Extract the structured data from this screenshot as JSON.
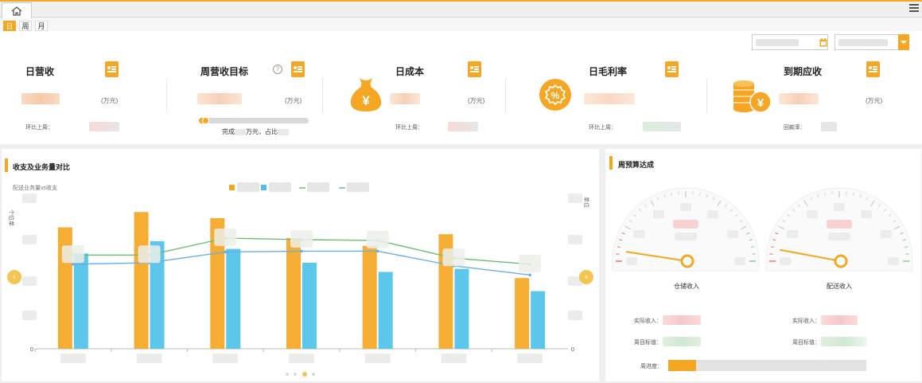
{
  "tabs": {
    "period": [
      "日",
      "周",
      "月"
    ],
    "active_index": 0
  },
  "icons": {
    "home": "home-icon",
    "menu": "hamburger-menu-icon",
    "calendar": "calendar-icon",
    "dropdown": "chevron-down-icon",
    "badge": "report-icon",
    "help": "question-circle-icon",
    "money_bag": "money-bag-icon",
    "percent": "percent-badge-icon",
    "coins": "coin-stack-icon"
  },
  "colors": {
    "accent": "#f5a623",
    "blue": "#4fc1e9",
    "green": "#6cc070",
    "line_blue": "#6aaee8"
  },
  "kpis": [
    {
      "title": "日营收",
      "unit": "(万元)",
      "compare_label": "环比上周："
    },
    {
      "title": "周营收目标",
      "unit": "(万元)",
      "progress": 0.06,
      "progress_text_prefix": "完成",
      "progress_text_mid": "万元，占比"
    },
    {
      "title": "日成本",
      "unit": "(万元)",
      "compare_label": "环比上周：",
      "icon": "¥"
    },
    {
      "title": "日毛利率",
      "compare_label": "环比上周：",
      "icon": "%"
    },
    {
      "title": "到期应收",
      "unit": "(万元)",
      "compare_label": "回款率：",
      "icon": "¥"
    }
  ],
  "left_panel": {
    "title": "收支及业务量对比",
    "subtitle": "配送业务量vs收支",
    "y_left_label": "个\n位\n单",
    "y_right_label": "单\n位",
    "zero_label": "0",
    "prev": "‹",
    "next": "›"
  },
  "chart_data": {
    "type": "bar",
    "categories": [
      "",
      "",
      "",
      "",
      "",
      "",
      ""
    ],
    "series": [
      {
        "type": "bar",
        "color": "#f5a623",
        "values": [
          158,
          178,
          170,
          144,
          134,
          149,
          92
        ]
      },
      {
        "type": "bar",
        "color": "#4fc1e9",
        "values": [
          124,
          140,
          130,
          112,
          100,
          104,
          75
        ]
      },
      {
        "type": "line",
        "color": "#6cc070",
        "values": [
          122,
          122,
          144,
          142,
          141,
          118,
          110
        ]
      },
      {
        "type": "line",
        "color": "#6aaee8",
        "values": [
          110,
          112,
          126,
          127,
          127,
          108,
          96
        ]
      }
    ],
    "ylim": [
      0,
      200
    ]
  },
  "right_panel": {
    "title": "周预算达成",
    "gauges": [
      {
        "label": "仓储收入",
        "value": 0.05
      },
      {
        "label": "配送收入",
        "value": 0.06
      }
    ],
    "rows": {
      "actual": "实际收入：",
      "target": "周目标值：",
      "week_progress": "周进度：",
      "week_progress_value": 0.14
    }
  }
}
